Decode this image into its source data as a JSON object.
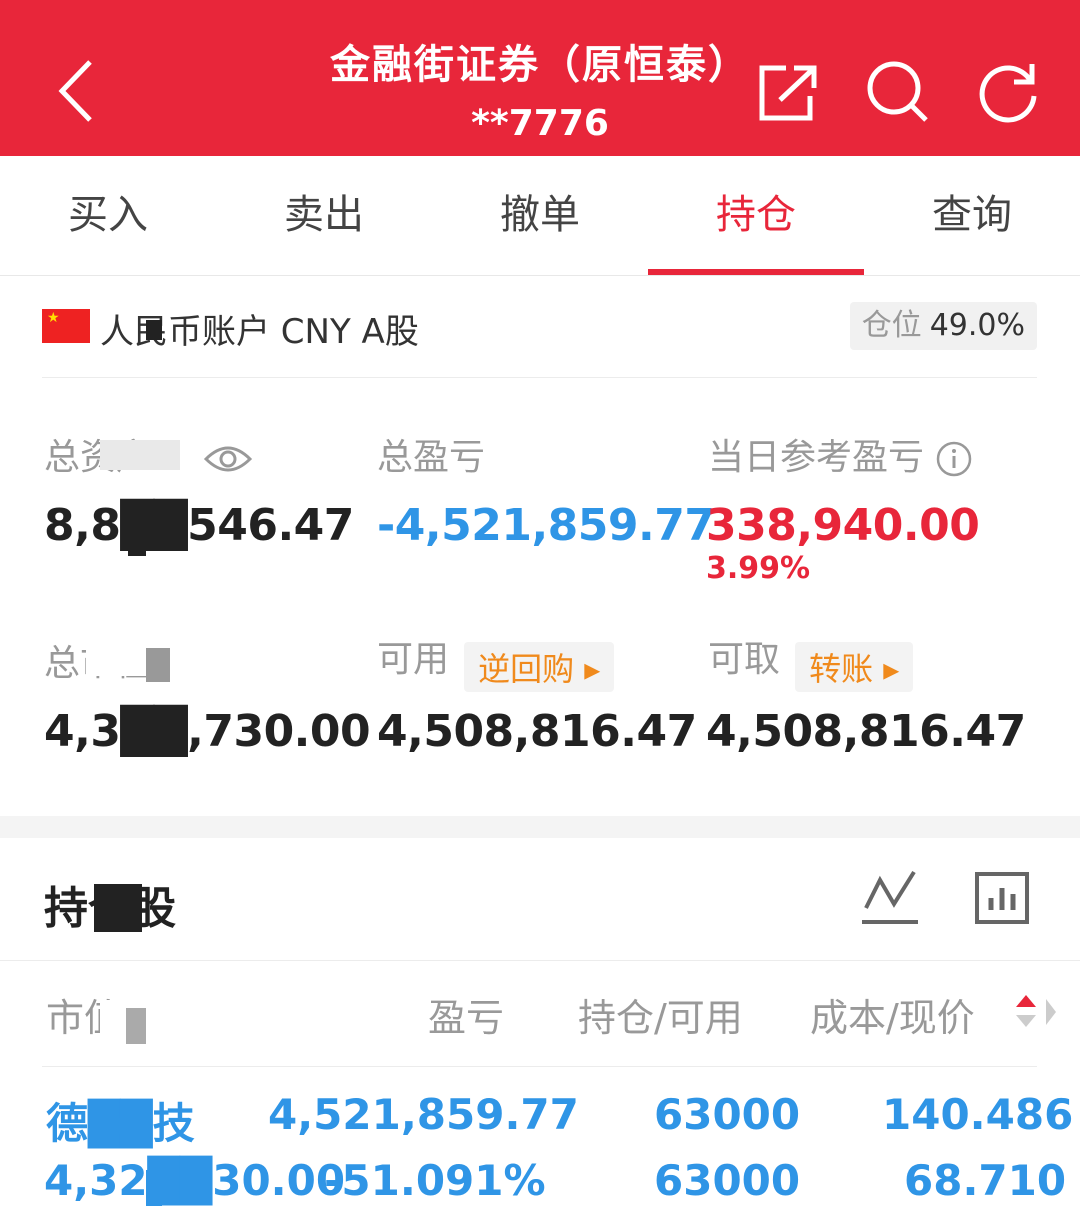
{
  "header": {
    "title": "金融街证券（原恒泰）",
    "subtitle": "**7776",
    "bg_color": "#e8263a"
  },
  "tabs": [
    {
      "label": "买入"
    },
    {
      "label": "卖出"
    },
    {
      "label": "撤单"
    },
    {
      "label": "持仓",
      "active": true
    },
    {
      "label": "查询"
    }
  ],
  "account": {
    "name": "人民币账户 CNY A股",
    "position_label": "仓位",
    "position_value": "49.0%"
  },
  "stats": {
    "total_assets_label": "总资产",
    "total_assets_value": "8,8██546.47",
    "total_pnl_label": "总盈亏",
    "total_pnl_value": "-4,521,859.77",
    "daily_pnl_label": "当日参考盈亏",
    "daily_pnl_value": "338,940.00",
    "daily_pnl_pct": "3.99%",
    "market_value_label": "总市值",
    "market_value_value": "4,3██,730.00",
    "available_label": "可用",
    "available_chip": "逆回购",
    "available_value": "4,508,816.47",
    "withdrawable_label": "可取",
    "withdrawable_chip": "转账",
    "withdrawable_value": "4,508,816.47"
  },
  "holdings": {
    "title": "持仓股",
    "columns": [
      "市值",
      "盈亏",
      "持仓/可用",
      "成本/现价"
    ],
    "rows": [
      {
        "name": "德██技",
        "market_value": "4,32██30.00",
        "pnl": "4,521,859.77",
        "pnl_pct": "-51.091%",
        "position": "63000",
        "available": "63000",
        "cost": "140.486",
        "price": "68.710"
      }
    ]
  }
}
